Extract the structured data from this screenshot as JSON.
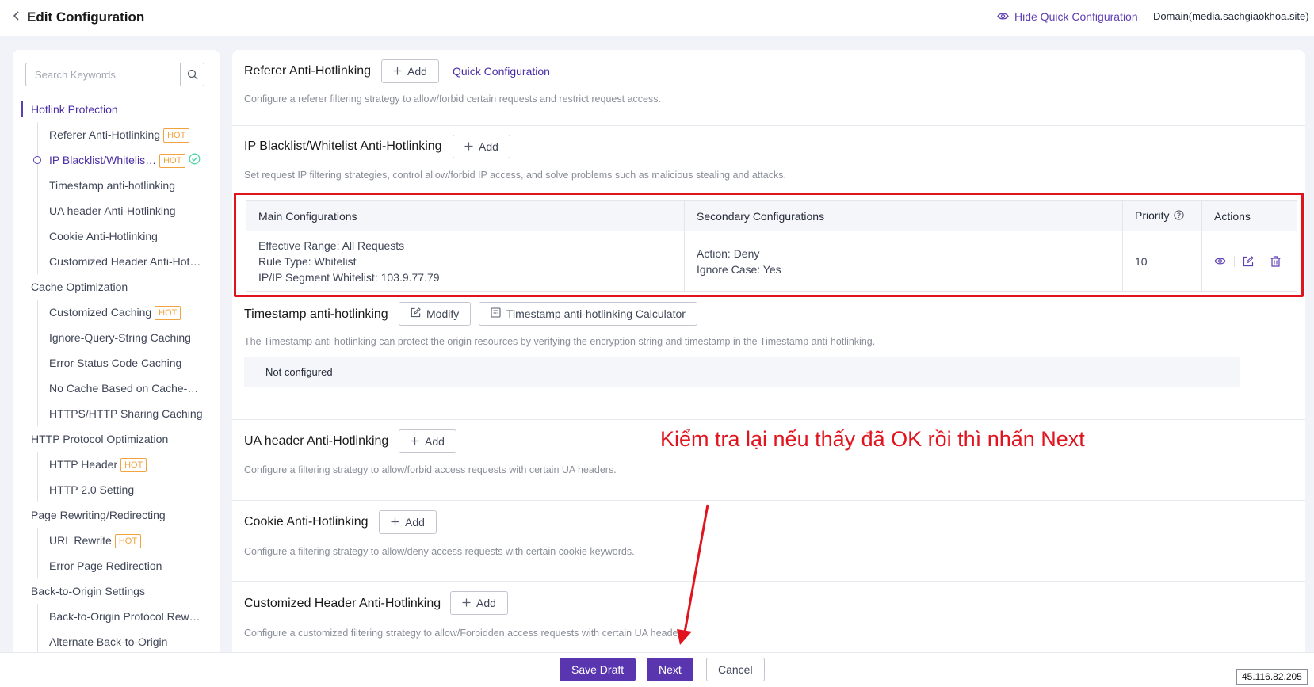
{
  "header": {
    "back_icon": "chevron-left-icon",
    "title": "Edit Configuration",
    "hide_quick_config": "Hide Quick Configuration",
    "domain": "Domain(media.sachgiaokhoa.site)"
  },
  "sidebar": {
    "search_placeholder": "Search Keywords",
    "hot_badge": "HOT",
    "groups": [
      {
        "label": "Hotlink Protection",
        "items": [
          "Referer Anti-Hotlinking",
          "IP Blacklist/Whitelis…",
          "Timestamp anti-hotlinking",
          "UA header Anti-Hotlinking",
          "Cookie Anti-Hotlinking",
          "Customized Header Anti-Hot…"
        ]
      },
      {
        "label": "Cache Optimization",
        "items": [
          "Customized Caching",
          "Ignore-Query-String Caching",
          "Error Status Code Caching",
          "No Cache Based on Cache-…",
          "HTTPS/HTTP Sharing Caching"
        ]
      },
      {
        "label": "HTTP Protocol Optimization",
        "items": [
          "HTTP Header",
          "HTTP 2.0 Setting"
        ]
      },
      {
        "label": "Page Rewriting/Redirecting",
        "items": [
          "URL Rewrite",
          "Error Page Redirection"
        ]
      },
      {
        "label": "Back-to-Origin Settings",
        "items": [
          "Back-to-Origin Protocol Rew…",
          "Alternate Back-to-Origin"
        ]
      }
    ]
  },
  "main": {
    "add_label": "Add",
    "referer": {
      "title": "Referer Anti-Hotlinking",
      "quick_config": "Quick Configuration",
      "desc": "Configure a referer filtering strategy to allow/forbid certain requests and restrict request access."
    },
    "ip": {
      "title": "IP Blacklist/Whitelist Anti-Hotlinking",
      "desc": "Set request IP filtering strategies, control allow/forbid IP access, and solve problems such as malicious stealing and attacks.",
      "columns": [
        "Main Configurations",
        "Secondary Configurations",
        "Priority",
        "Actions"
      ],
      "row": {
        "main": [
          "Effective Range: All Requests",
          "Rule Type: Whitelist",
          "IP/IP Segment Whitelist: 103.9.77.79"
        ],
        "secondary": [
          "Action: Deny",
          "Ignore Case: Yes"
        ],
        "priority": "10",
        "action_icons": [
          "eye-icon",
          "edit-icon",
          "delete-icon"
        ]
      }
    },
    "timestamp": {
      "title": "Timestamp anti-hotlinking",
      "modify": "Modify",
      "calculator": "Timestamp anti-hotlinking Calculator",
      "desc": "The Timestamp anti-hotlinking can protect the origin resources by verifying the encryption string and timestamp in the Timestamp anti-hotlinking.",
      "status": "Not configured"
    },
    "ua": {
      "title": "UA header Anti-Hotlinking",
      "desc": "Configure a filtering strategy to allow/forbid access requests with certain UA headers."
    },
    "cookie": {
      "title": "Cookie Anti-Hotlinking",
      "desc": "Configure a filtering strategy to allow/deny access requests with certain cookie keywords."
    },
    "custom_header": {
      "title": "Customized Header Anti-Hotlinking",
      "desc": "Configure a customized filtering strategy to allow/Forbidden access requests with certain UA headers."
    }
  },
  "annotation": "Kiểm tra lại nếu thấy đã OK rồi thì nhấn Next",
  "colors": {
    "accent": "#5a35b0",
    "highlight_red": "#e0141e",
    "hot_orange": "#f2a340",
    "ok_green": "#50d4ab"
  },
  "footer": {
    "save_draft": "Save Draft",
    "next": "Next",
    "cancel": "Cancel"
  },
  "ip_badge": "45.116.82.205"
}
